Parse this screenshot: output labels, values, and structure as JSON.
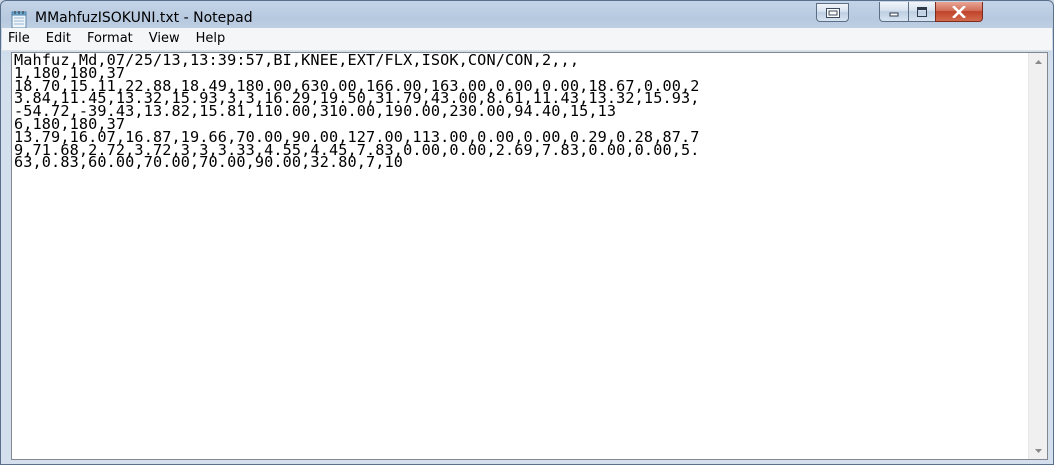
{
  "window": {
    "title": "MMahfuzISOKUNI.txt - Notepad",
    "controls": {
      "extra_icon": "window-thumbnail-icon",
      "minimize_icon": "minimize-icon",
      "maximize_icon": "maximize-icon",
      "close_icon": "close-icon"
    }
  },
  "menu": {
    "items": [
      {
        "label": "File"
      },
      {
        "label": "Edit"
      },
      {
        "label": "Format"
      },
      {
        "label": "View"
      },
      {
        "label": "Help"
      }
    ]
  },
  "editor": {
    "content": "Mahfuz,Md,07/25/13,13:39:57,BI,KNEE,EXT/FLX,ISOK,CON/CON,2,,,\n1,180,180,37\n18.70,15.11,22.88,18.49,180.00,630.00,166.00,163.00,0.00,0.00,18.67,0.00,2\n3.84,11.45,13.32,15.93,3,3,16.29,19.50,31.79,43.00,8.61,11.43,13.32,15.93,\n-54.72,-39.43,13.82,15.81,110.00,310.00,190.00,230.00,94.40,15,13\n6,180,180,37\n13.79,16.07,16.87,19.66,70.00,90.00,127.00,113.00,0.00,0.00,0.29,0.28,87.7\n9,71.68,2.72,3.72,3,3,3.33,4.55,4.45,7.83,0.00,0.00,2.69,7.83,0.00,0.00,5.\n63,0.83,60.00,70.00,70.00,90.00,32.80,7,10"
  },
  "scrollbar": {
    "up_icon": "scroll-up-arrow-icon",
    "down_icon": "scroll-down-arrow-icon"
  },
  "colors": {
    "close_button": "#c0432a",
    "title_bar": "#b7c9df",
    "menu_bar": "#f5f6f7"
  }
}
